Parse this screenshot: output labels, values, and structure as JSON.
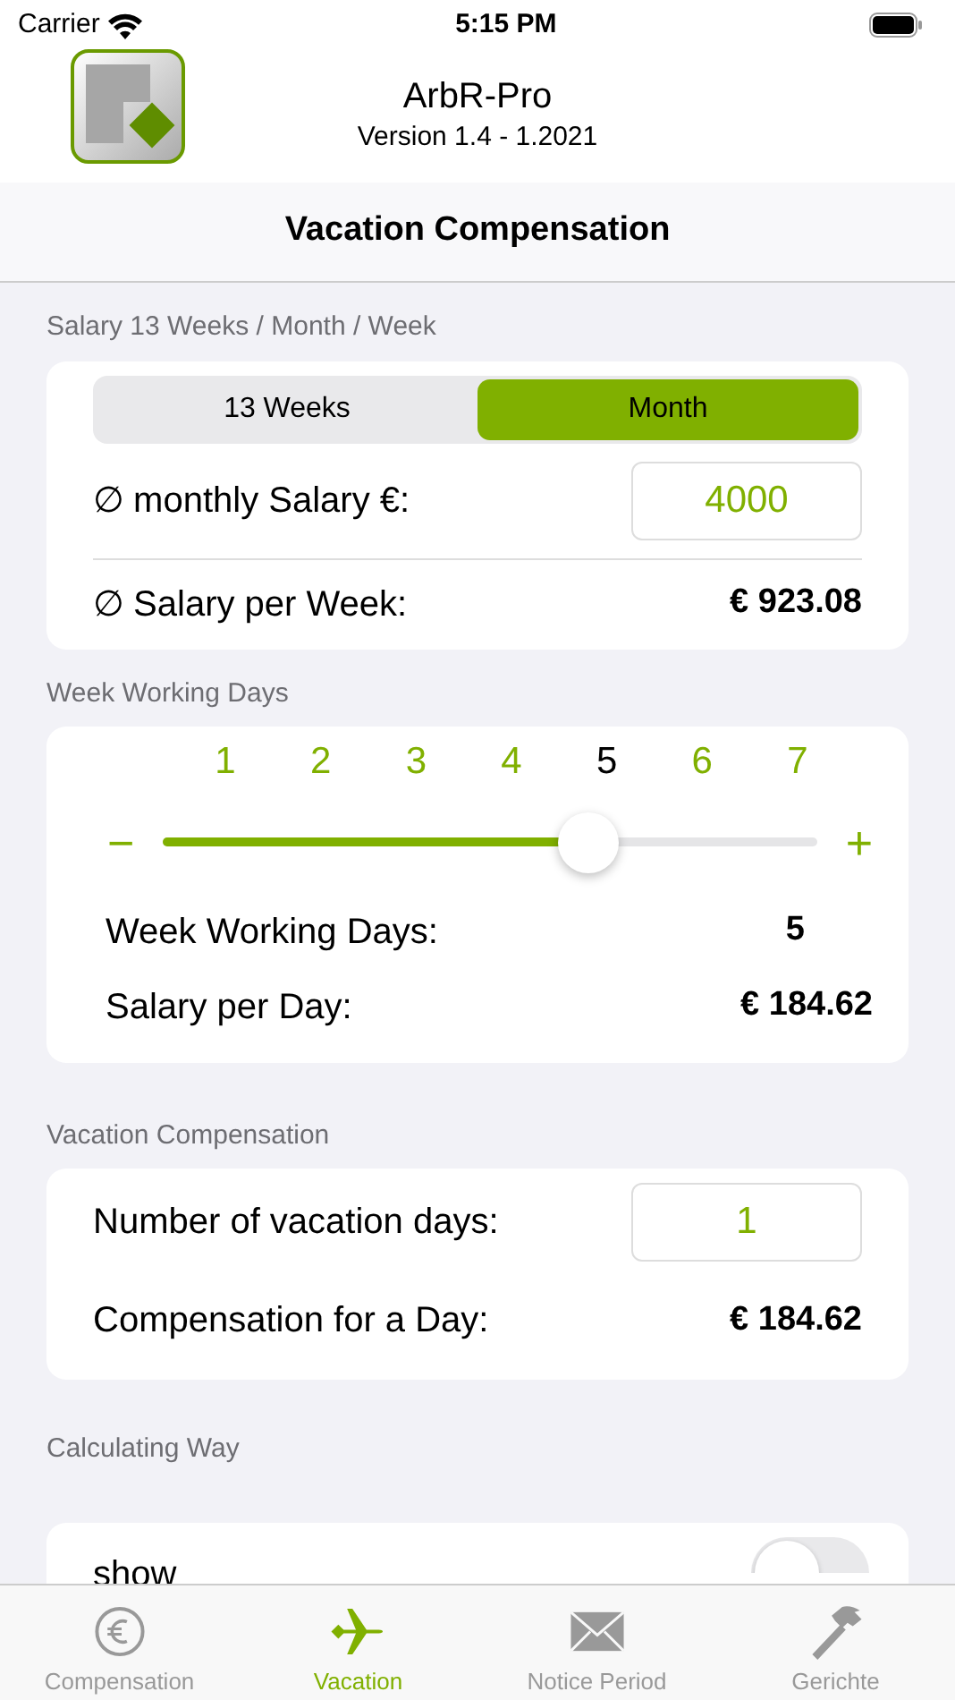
{
  "status_bar": {
    "carrier": "Carrier",
    "time": "5:15 PM"
  },
  "header": {
    "app_name": "ArbR-Pro",
    "version": "Version 1.4 - 1.2021"
  },
  "nav_title": "Vacation Compensation",
  "salary": {
    "heading": "Salary 13 Weeks / Month / Week",
    "segments": [
      {
        "label": "13 Weeks",
        "selected": false
      },
      {
        "label": "Month",
        "selected": true
      }
    ],
    "monthly_label": "∅ monthly Salary €:",
    "monthly_value": "4000",
    "week_label": "∅ Salary per Week:",
    "week_value": "€  923.08"
  },
  "working_days": {
    "heading": "Week Working Days",
    "days": [
      {
        "label": "1",
        "selected": false
      },
      {
        "label": "2",
        "selected": false
      },
      {
        "label": "3",
        "selected": false
      },
      {
        "label": "4",
        "selected": false
      },
      {
        "label": "5",
        "selected": true
      },
      {
        "label": "6",
        "selected": false
      },
      {
        "label": "7",
        "selected": false
      }
    ],
    "minus": "−",
    "plus": "+",
    "level": 0.65,
    "days_label": "Week Working Days:",
    "days_value": "5",
    "day_label": "Salary per Day:",
    "day_value": "€  184.62"
  },
  "vacation": {
    "heading": "Vacation Compensation",
    "days_label": "Number of vacation days:",
    "days_value": "1",
    "comp_label": "Compensation for a Day:",
    "comp_value": "€  184.62"
  },
  "calculating": {
    "heading": "Calculating Way",
    "show_label": "show",
    "on": false
  },
  "tab_bar": [
    {
      "label": "Compensation",
      "kind": "euro",
      "selected": false
    },
    {
      "label": "Vacation",
      "kind": "plane",
      "selected": true
    },
    {
      "label": "Notice Period",
      "kind": "mail",
      "selected": false
    },
    {
      "label": "Gerichte",
      "kind": "hammer",
      "selected": false
    }
  ]
}
